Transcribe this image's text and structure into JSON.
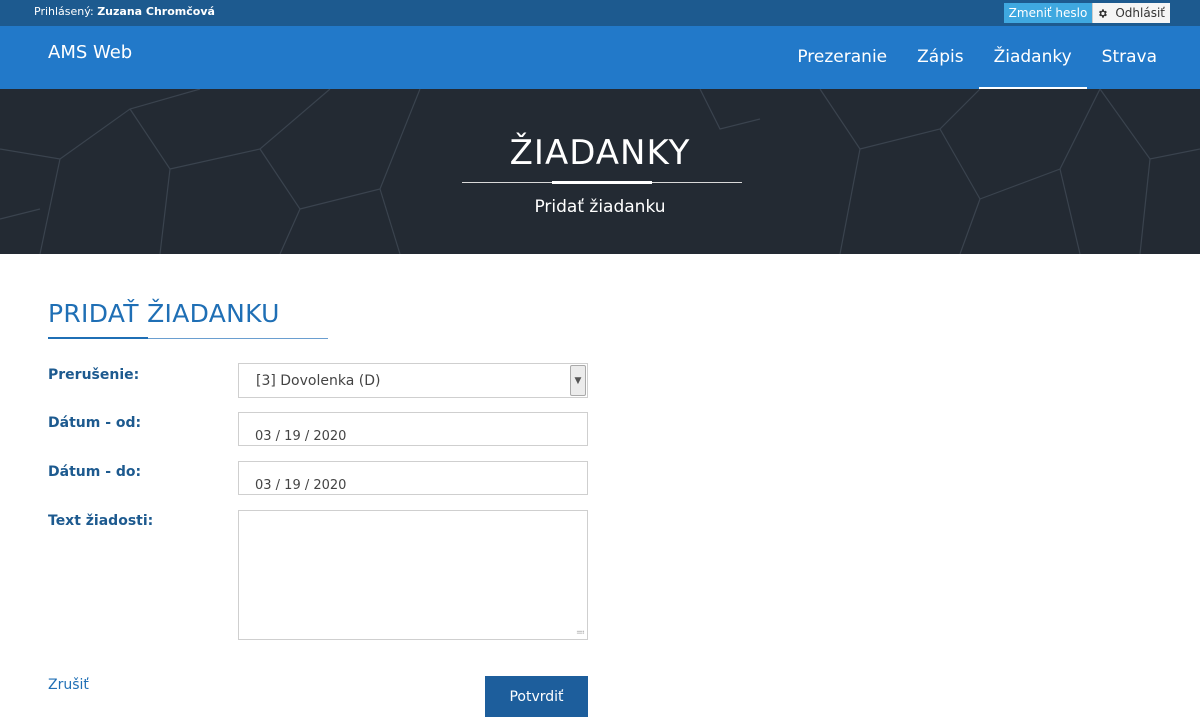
{
  "topbar": {
    "user_prefix": "Prihlásený:",
    "user_name": "Zuzana Chromčová",
    "change_password_label": "Zmeniť heslo",
    "gear_icon": "gear-icon",
    "logout_label": "Odhlásiť"
  },
  "navbar": {
    "brand": "AMS Web",
    "items": [
      {
        "label": "Prezeranie"
      },
      {
        "label": "Zápis"
      },
      {
        "label": "Žiadanky"
      },
      {
        "label": "Strava"
      }
    ],
    "active_item": "Žiadanky"
  },
  "hero": {
    "title": "ŽIADANKY",
    "subtitle": "Pridať žiadanku"
  },
  "form": {
    "title": "PRIDAŤ ŽIADANKU",
    "interruption_label": "Prerušenie:",
    "interruption_value": "[3] Dovolenka (D)",
    "date_from_label": "Dátum - od:",
    "date_from_value": "03 / 19 / 2020",
    "date_to_label": "Dátum - do:",
    "date_to_value": "03 / 19 / 2020",
    "request_text_label": "Text žiadosti:",
    "request_text_value": "",
    "cancel_label": "Zrušiť",
    "submit_label": "Potvrdiť"
  },
  "colors": {
    "topbar_bg": "#1d5a8f",
    "navbar_bg": "#2279c9",
    "hero_bg": "#232a33",
    "accent": "#1f6fb5",
    "button_bg": "#1d5e9c",
    "change_password_bg": "#3fa8e0"
  }
}
